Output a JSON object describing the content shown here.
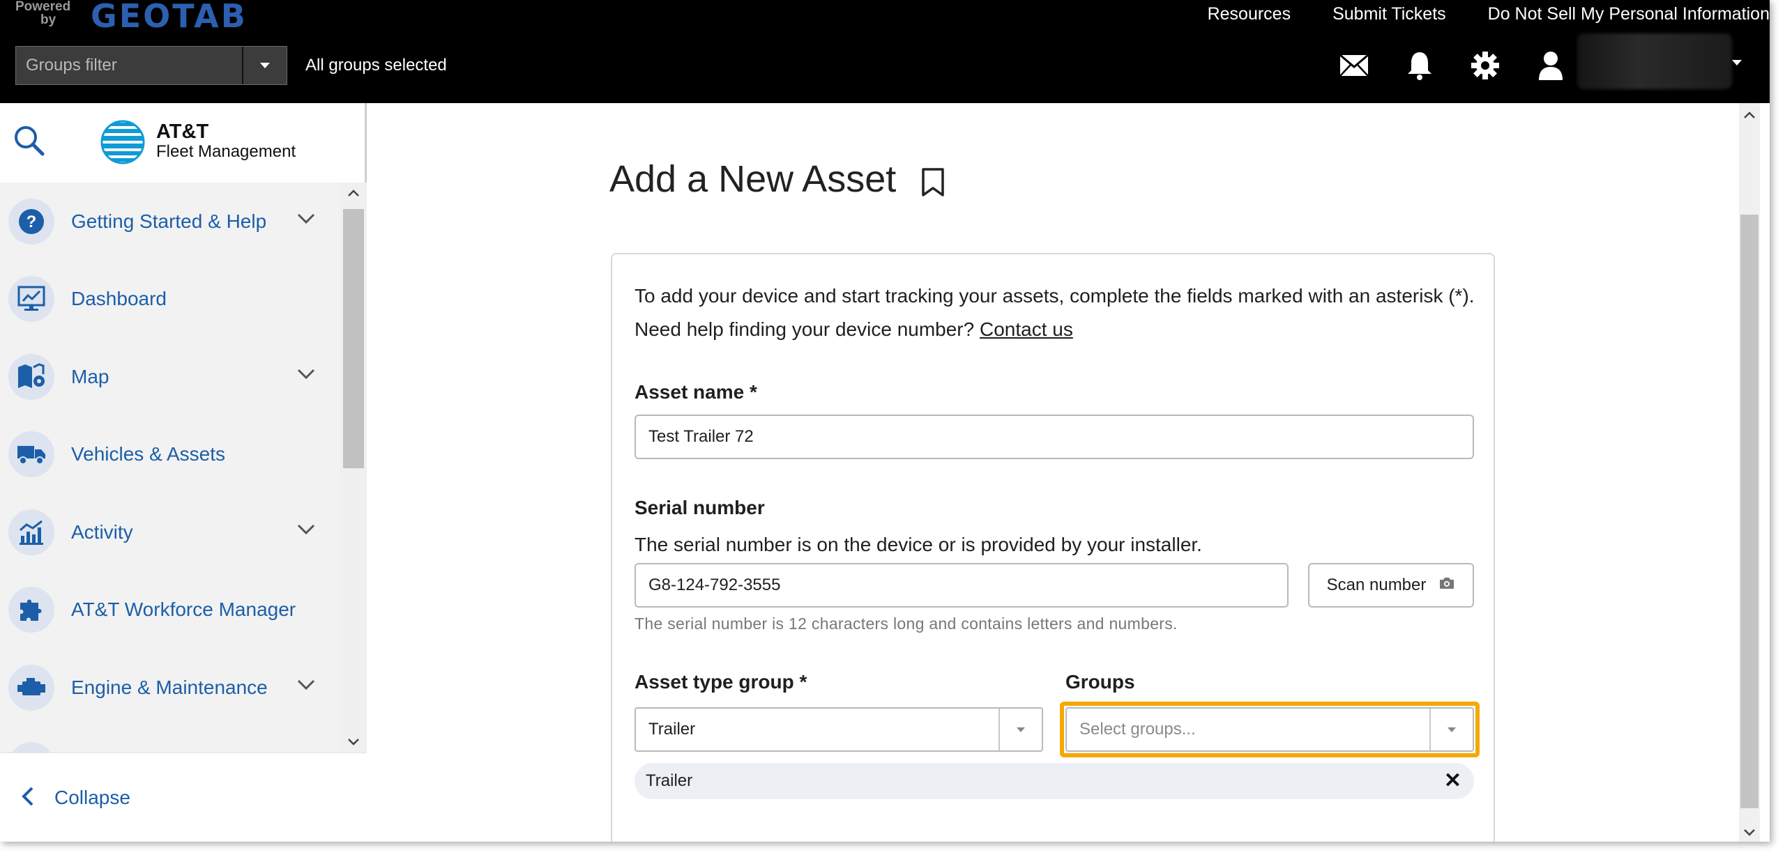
{
  "header": {
    "powered_line1": "Powered",
    "powered_line2": "by",
    "brand": "GEOTAB",
    "links": [
      "Resources",
      "Submit Tickets",
      "Do Not Sell My Personal Information"
    ],
    "groups_filter_placeholder": "Groups filter",
    "groups_status": "All groups selected",
    "icons": [
      "mail-icon",
      "bell-icon",
      "gear-icon",
      "user-icon"
    ]
  },
  "sidebar": {
    "logo_line1": "AT&T",
    "logo_line2": "Fleet Management",
    "items": [
      {
        "label": "Getting Started & Help",
        "icon": "help-icon",
        "expandable": true
      },
      {
        "label": "Dashboard",
        "icon": "dashboard-icon",
        "expandable": false
      },
      {
        "label": "Map",
        "icon": "map-icon",
        "expandable": true
      },
      {
        "label": "Vehicles & Assets",
        "icon": "truck-icon",
        "expandable": false
      },
      {
        "label": "Activity",
        "icon": "activity-chart-icon",
        "expandable": true
      },
      {
        "label": "AT&T Workforce Manager",
        "icon": "puzzle-icon",
        "expandable": false
      },
      {
        "label": "Engine & Maintenance",
        "icon": "engine-icon",
        "expandable": true
      }
    ],
    "collapse_label": "Collapse"
  },
  "main": {
    "title": "Add a New Asset",
    "intro_line1": "To add your device and start tracking your assets, complete the fields marked with an asterisk (*).",
    "intro_line2_prefix": "Need help finding your device number?",
    "intro_link": "Contact us",
    "asset_name": {
      "label": "Asset name *",
      "value": "Test Trailer 72"
    },
    "serial": {
      "label": "Serial number",
      "help": "The serial number is on the device or is provided by your installer.",
      "value": "G8-124-792-3555",
      "scan_label": "Scan number",
      "hint": "The serial number is 12 characters long and contains letters and numbers."
    },
    "asset_type_group": {
      "label": "Asset type group *",
      "value": "Trailer"
    },
    "groups": {
      "label": "Groups",
      "placeholder": "Select groups...",
      "chips": [
        "Trailer"
      ]
    },
    "accent_color": "#f5a800",
    "link_color": "#1c5ea8"
  }
}
